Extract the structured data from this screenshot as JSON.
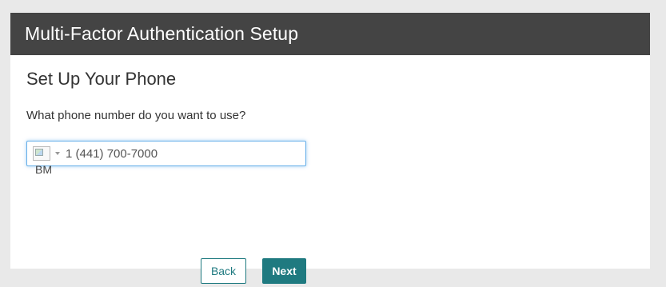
{
  "header": {
    "title": "Multi-Factor Authentication Setup"
  },
  "main": {
    "section_title": "Set Up Your Phone",
    "question": "What phone number do you want to use?",
    "phone": {
      "country_code": "BM",
      "value": "1 (441) 700-7000",
      "flag_icon": "flag-icon-broken-image"
    },
    "buttons": {
      "back_label": "Back",
      "next_label": "Next"
    }
  },
  "colors": {
    "header_bg": "#444444",
    "accent": "#1f7a80",
    "focus_border": "#66afe9",
    "page_bg": "#e9e9e9"
  }
}
